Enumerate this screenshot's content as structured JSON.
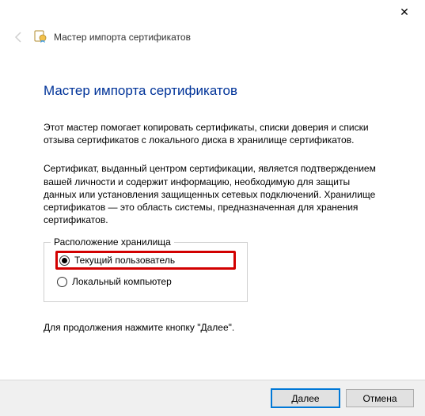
{
  "window": {
    "close_label": "✕"
  },
  "header": {
    "title": "Мастер импорта сертификатов"
  },
  "main": {
    "heading": "Мастер импорта сертификатов",
    "intro": "Этот мастер помогает копировать сертификаты, списки доверия и списки отзыва сертификатов с локального диска в хранилище сертификатов.",
    "description": "Сертификат, выданный центром сертификации, является подтверждением вашей личности и содержит информацию, необходимую для защиты данных или установления защищенных сетевых подключений. Хранилище сертификатов — это область системы, предназначенная для хранения сертификатов.",
    "storage": {
      "legend": "Расположение хранилища",
      "options": [
        {
          "label": "Текущий пользователь",
          "selected": true
        },
        {
          "label": "Локальный компьютер",
          "selected": false
        }
      ]
    },
    "continue_hint": "Для продолжения нажмите кнопку \"Далее\"."
  },
  "footer": {
    "next": "Далее",
    "cancel": "Отмена"
  }
}
